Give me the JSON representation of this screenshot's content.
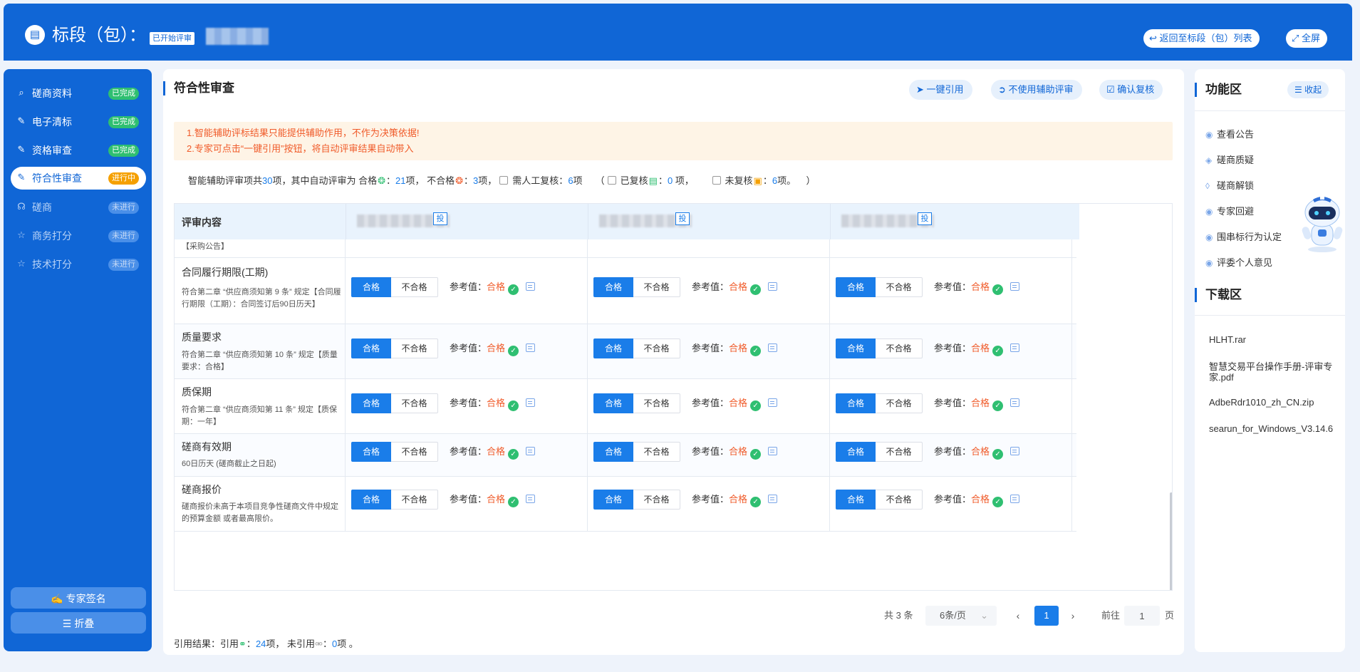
{
  "header": {
    "title": "标段（包）：",
    "badge": "已开始评审",
    "back_button": "返回至标段（包）列表",
    "fullscreen_button": "全屏"
  },
  "sidebar": {
    "items": [
      {
        "label": "磋商资料",
        "status": "已完成",
        "state": "done",
        "icon": "search-doc-icon"
      },
      {
        "label": "电子清标",
        "status": "已完成",
        "state": "done",
        "icon": "edit-doc-icon"
      },
      {
        "label": "资格审查",
        "status": "已完成",
        "state": "done",
        "icon": "edit-doc-icon"
      },
      {
        "label": "符合性审查",
        "status": "进行中",
        "state": "doing",
        "icon": "edit-doc-icon"
      },
      {
        "label": "磋商",
        "status": "未进行",
        "state": "todo",
        "icon": "chat-icon"
      },
      {
        "label": "商务打分",
        "status": "未进行",
        "state": "todo",
        "icon": "star-icon"
      },
      {
        "label": "技术打分",
        "status": "未进行",
        "state": "todo",
        "icon": "star-icon"
      }
    ],
    "sign_button": "专家签名",
    "fold_button": "折叠"
  },
  "main": {
    "title": "符合性审查",
    "btn_quote": "一键引用",
    "btn_no_assist": "不使用辅助评审",
    "btn_confirm": "确认复核",
    "notice": [
      "1.智能辅助评标结果只能提供辅助作用，不作为决策依据!",
      "2.专家可点击“一键引用”按钮，将自动评审结果自动带入"
    ],
    "summary": {
      "p1": "智能辅助评审项共",
      "total": "30",
      "p2": "项，其中自动评审为 合格",
      "p3": "：",
      "pass": "21",
      "p4": "项，  不合格",
      "p5": "：",
      "fail": "3",
      "p6": "项，",
      "p7": "需人工复核：",
      "manual": "6",
      "p8": "项",
      "p9": "（",
      "p10": "已复核",
      "p11": "：",
      "reviewed": "0",
      "p12": " 项，",
      "p13": "未复核",
      "p14": "：",
      "unreviewed": "6",
      "p15": "项。",
      "p16": "）"
    },
    "table": {
      "col_header": "评审内容",
      "vendor_tag": "投",
      "pass_label": "合格",
      "fail_label": "不合格",
      "ref_label": "参考值：",
      "ref_value": "合格",
      "top_partial": "【采购公告】",
      "rows": [
        {
          "title": "合同履行期限(工期)",
          "desc": "符合第二章 “供应商须知第 9 条” 规定【合同履行期限（工期）：合同签订后90日历天】"
        },
        {
          "title": "质量要求",
          "desc": "符合第二章 “供应商须知第 10 条” 规定【质量要求：合格】"
        },
        {
          "title": "质保期",
          "desc": "符合第二章 “供应商须知第 11 条” 规定【质保期：一年】"
        },
        {
          "title": "磋商有效期",
          "desc": "60日历天 (磋商截止之日起)"
        },
        {
          "title": "磋商报价",
          "desc": "磋商报价未高于本项目竞争性磋商文件中规定的预算金额 或者最高限价。"
        }
      ]
    },
    "pagination": {
      "total": "共 3 条",
      "page_size": "6条/页",
      "current": "1",
      "goto_label": "前往",
      "goto_value": "1",
      "page_unit": "页"
    },
    "result": {
      "p1": "引用结果：引用",
      "p2": "：",
      "quoted": "24",
      "p3": "项，  未引用",
      "p4": "：",
      "unquoted": "0",
      "p5": "项 。"
    }
  },
  "right": {
    "func_title": "功能区",
    "collapse_button": "收起",
    "func_items": [
      "查看公告",
      "磋商质疑",
      "磋商解锁",
      "专家回避",
      "围串标行为认定",
      "评委个人意见"
    ],
    "download_title": "下载区",
    "downloads": [
      "HLHT.rar",
      "智慧交易平台操作手册-评审专家.pdf",
      "AdbeRdr1010_zh_CN.zip",
      "searun_for_Windows_V3.14.6"
    ]
  }
}
